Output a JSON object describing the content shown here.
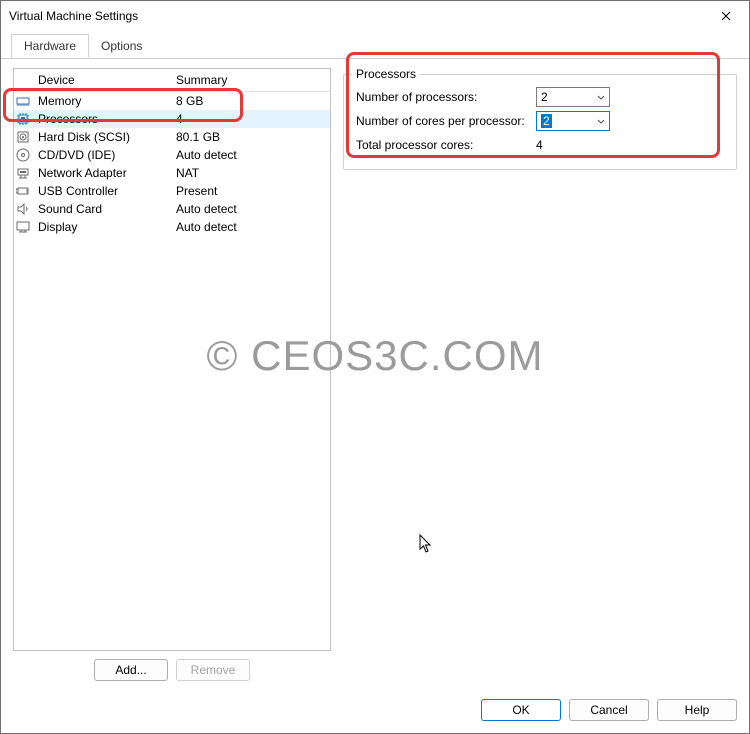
{
  "window": {
    "title": "Virtual Machine Settings"
  },
  "tabs": {
    "hardware": "Hardware",
    "options": "Options",
    "active": "hardware"
  },
  "device_columns": {
    "device": "Device",
    "summary": "Summary"
  },
  "devices": [
    {
      "icon": "memory-icon",
      "name": "Memory",
      "summary": "8 GB",
      "selected": false
    },
    {
      "icon": "processor-icon",
      "name": "Processors",
      "summary": "4",
      "selected": true
    },
    {
      "icon": "harddisk-icon",
      "name": "Hard Disk (SCSI)",
      "summary": "80.1 GB",
      "selected": false
    },
    {
      "icon": "cddvd-icon",
      "name": "CD/DVD (IDE)",
      "summary": "Auto detect",
      "selected": false
    },
    {
      "icon": "network-icon",
      "name": "Network Adapter",
      "summary": "NAT",
      "selected": false
    },
    {
      "icon": "usb-icon",
      "name": "USB Controller",
      "summary": "Present",
      "selected": false
    },
    {
      "icon": "sound-icon",
      "name": "Sound Card",
      "summary": "Auto detect",
      "selected": false
    },
    {
      "icon": "display-icon",
      "name": "Display",
      "summary": "Auto detect",
      "selected": false
    }
  ],
  "left_buttons": {
    "add": "Add...",
    "remove": "Remove"
  },
  "processors_group": {
    "title": "Processors",
    "num_processors_label": "Number of processors:",
    "num_processors_value": "2",
    "num_cores_label": "Number of cores per processor:",
    "num_cores_value": "2",
    "total_label": "Total processor cores:",
    "total_value": "4"
  },
  "footer": {
    "ok": "OK",
    "cancel": "Cancel",
    "help": "Help"
  },
  "watermark": "© CEOS3C.COM"
}
